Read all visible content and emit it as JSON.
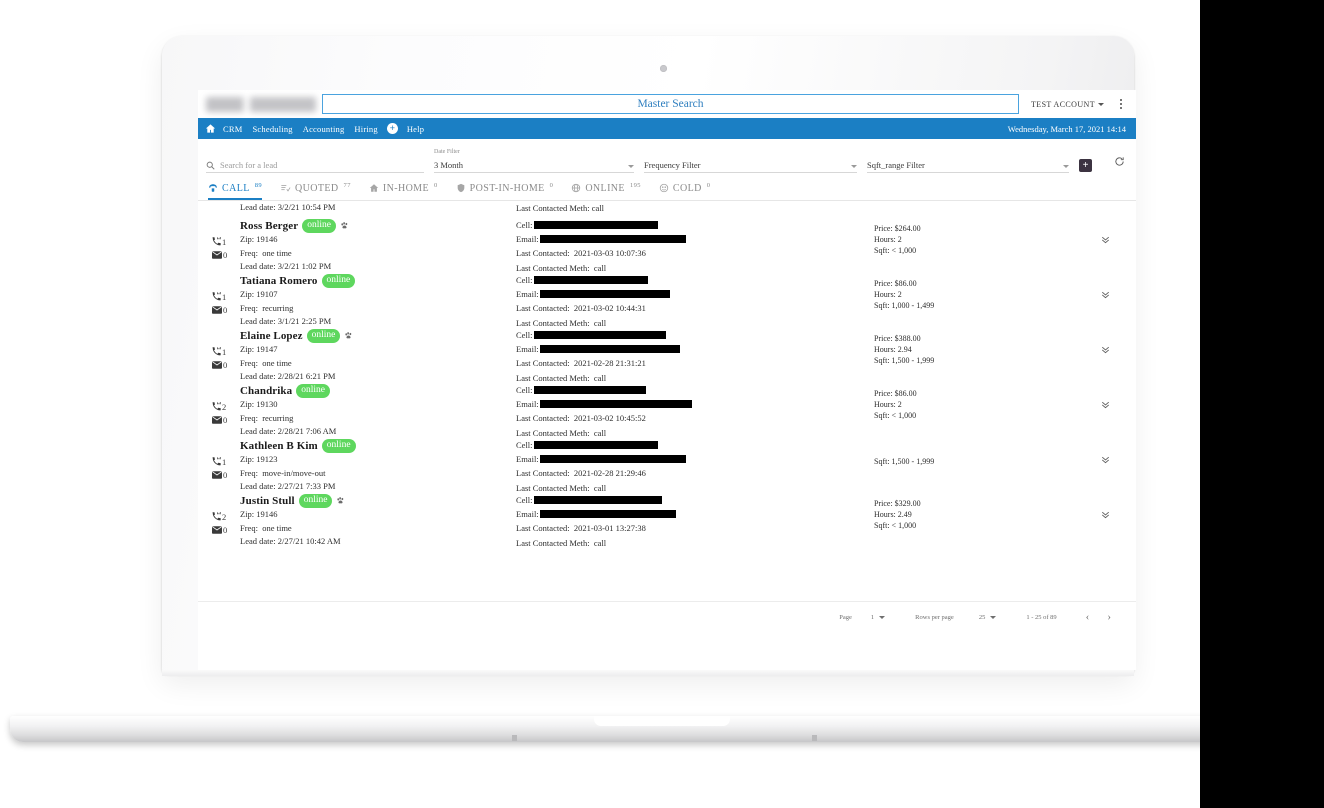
{
  "topbar": {
    "logo_alt": "company-logo-redacted",
    "master_search_placeholder": "Master Search",
    "master_search_value": "",
    "account_label": "TEST ACCOUNT",
    "kebab_label": "More options"
  },
  "nav": {
    "home_icon": "home-icon",
    "items": [
      "CRM",
      "Scheduling",
      "Accounting",
      "Hiring"
    ],
    "plus_label": "+",
    "help_label": "Help",
    "datetime": "Wednesday, March 17, 2021 14:14"
  },
  "filters": {
    "search_placeholder": "Search for a lead",
    "search_value": "",
    "date_filter": {
      "label": "Date Filter",
      "value": "3 Month"
    },
    "frequency_filter": {
      "label": "",
      "value": "Frequency Filter"
    },
    "sqft_filter": {
      "label": "",
      "value": "Sqft_range Filter"
    },
    "add_label": "+",
    "refresh_label": "Refresh"
  },
  "tabs": [
    {
      "label": "CALL",
      "count": "89",
      "icon": "phone-icon",
      "active": true
    },
    {
      "label": "QUOTED",
      "count": "77",
      "icon": "list-check-icon",
      "active": false
    },
    {
      "label": "IN-HOME",
      "count": "0",
      "icon": "home-icon",
      "active": false
    },
    {
      "label": "POST-IN-HOME",
      "count": "0",
      "icon": "shield-icon",
      "active": false
    },
    {
      "label": "ONLINE",
      "count": "195",
      "icon": "globe-icon",
      "active": false
    },
    {
      "label": "COLD",
      "count": "0",
      "icon": "smiley-icon",
      "active": false
    }
  ],
  "list": {
    "clipped_row": {
      "lead_date": "Lead date: 3/2/21 10:54 PM",
      "last_contacted_meth": "Last Contacted Meth: call"
    },
    "labels": {
      "zip": "Zip:",
      "freq": "Freq:",
      "lead_date": "Lead date:",
      "cell": "Cell:",
      "email": "Email:",
      "last_contacted": "Last Contacted:",
      "last_contacted_meth": "Last Contacted Meth:",
      "price": "Price:",
      "hours": "Hours:",
      "sqft": "Sqft:"
    },
    "rows": [
      {
        "name": "Ross Berger",
        "status": "online",
        "has_paw": true,
        "calls": "1",
        "emails": "0",
        "zip": "19146",
        "freq": "one time",
        "lead_date": "3/2/21 1:02 PM",
        "cell": "",
        "email": "",
        "last_contacted": "2021-03-03 10:07:36",
        "last_contacted_meth": "call",
        "price": "$264.00",
        "hours": "2",
        "sqft": "< 1,000"
      },
      {
        "name": "Tatiana Romero",
        "status": "online",
        "has_paw": false,
        "calls": "1",
        "emails": "0",
        "zip": "19107",
        "freq": "recurring",
        "lead_date": "3/1/21 2:25 PM",
        "cell": "",
        "email": "",
        "last_contacted": "2021-03-02 10:44:31",
        "last_contacted_meth": "call",
        "price": "$86.00",
        "hours": "2",
        "sqft": "1,000 - 1,499"
      },
      {
        "name": "Elaine Lopez",
        "status": "online",
        "has_paw": true,
        "calls": "1",
        "emails": "0",
        "zip": "19147",
        "freq": "one time",
        "lead_date": "2/28/21 6:21 PM",
        "cell": "",
        "email": "",
        "last_contacted": "2021-02-28 21:31:21",
        "last_contacted_meth": "call",
        "price": "$388.00",
        "hours": "2.94",
        "sqft": "1,500 - 1,999"
      },
      {
        "name": "Chandrika",
        "status": "online",
        "has_paw": false,
        "calls": "2",
        "emails": "0",
        "zip": "19130",
        "freq": "recurring",
        "lead_date": "2/28/21 7:06 AM",
        "cell": "",
        "email": "",
        "last_contacted": "2021-03-02 10:45:52",
        "last_contacted_meth": "call",
        "price": "$86.00",
        "hours": "2",
        "sqft": "< 1,000"
      },
      {
        "name": "Kathleen B Kim",
        "status": "online",
        "has_paw": false,
        "calls": "1",
        "emails": "0",
        "zip": "19123",
        "freq": "move-in/move-out",
        "lead_date": "2/27/21 7:33 PM",
        "cell": "",
        "email": "",
        "last_contacted": "2021-02-28 21:29:46",
        "last_contacted_meth": "call",
        "price": "",
        "hours": "",
        "sqft": "1,500 - 1,999"
      },
      {
        "name": "Justin Stull",
        "status": "online",
        "has_paw": true,
        "calls": "2",
        "emails": "0",
        "zip": "19146",
        "freq": "one time",
        "lead_date": "2/27/21 10:42 AM",
        "cell": "",
        "email": "",
        "last_contacted": "2021-03-01 13:27:38",
        "last_contacted_meth": "call",
        "price": "$329.00",
        "hours": "2.49",
        "sqft": "< 1,000"
      }
    ]
  },
  "pagination": {
    "page_label": "Page",
    "page_value": "1",
    "rows_per_page_label": "Rows per page",
    "rows_per_page_value": "25",
    "range_label": "1 - 25 of 89",
    "prev_label": "‹",
    "next_label": "›"
  },
  "colors": {
    "nav_blue": "#1b7fc4",
    "badge_green": "#5ed75e",
    "accent_dark": "#3c3341"
  }
}
